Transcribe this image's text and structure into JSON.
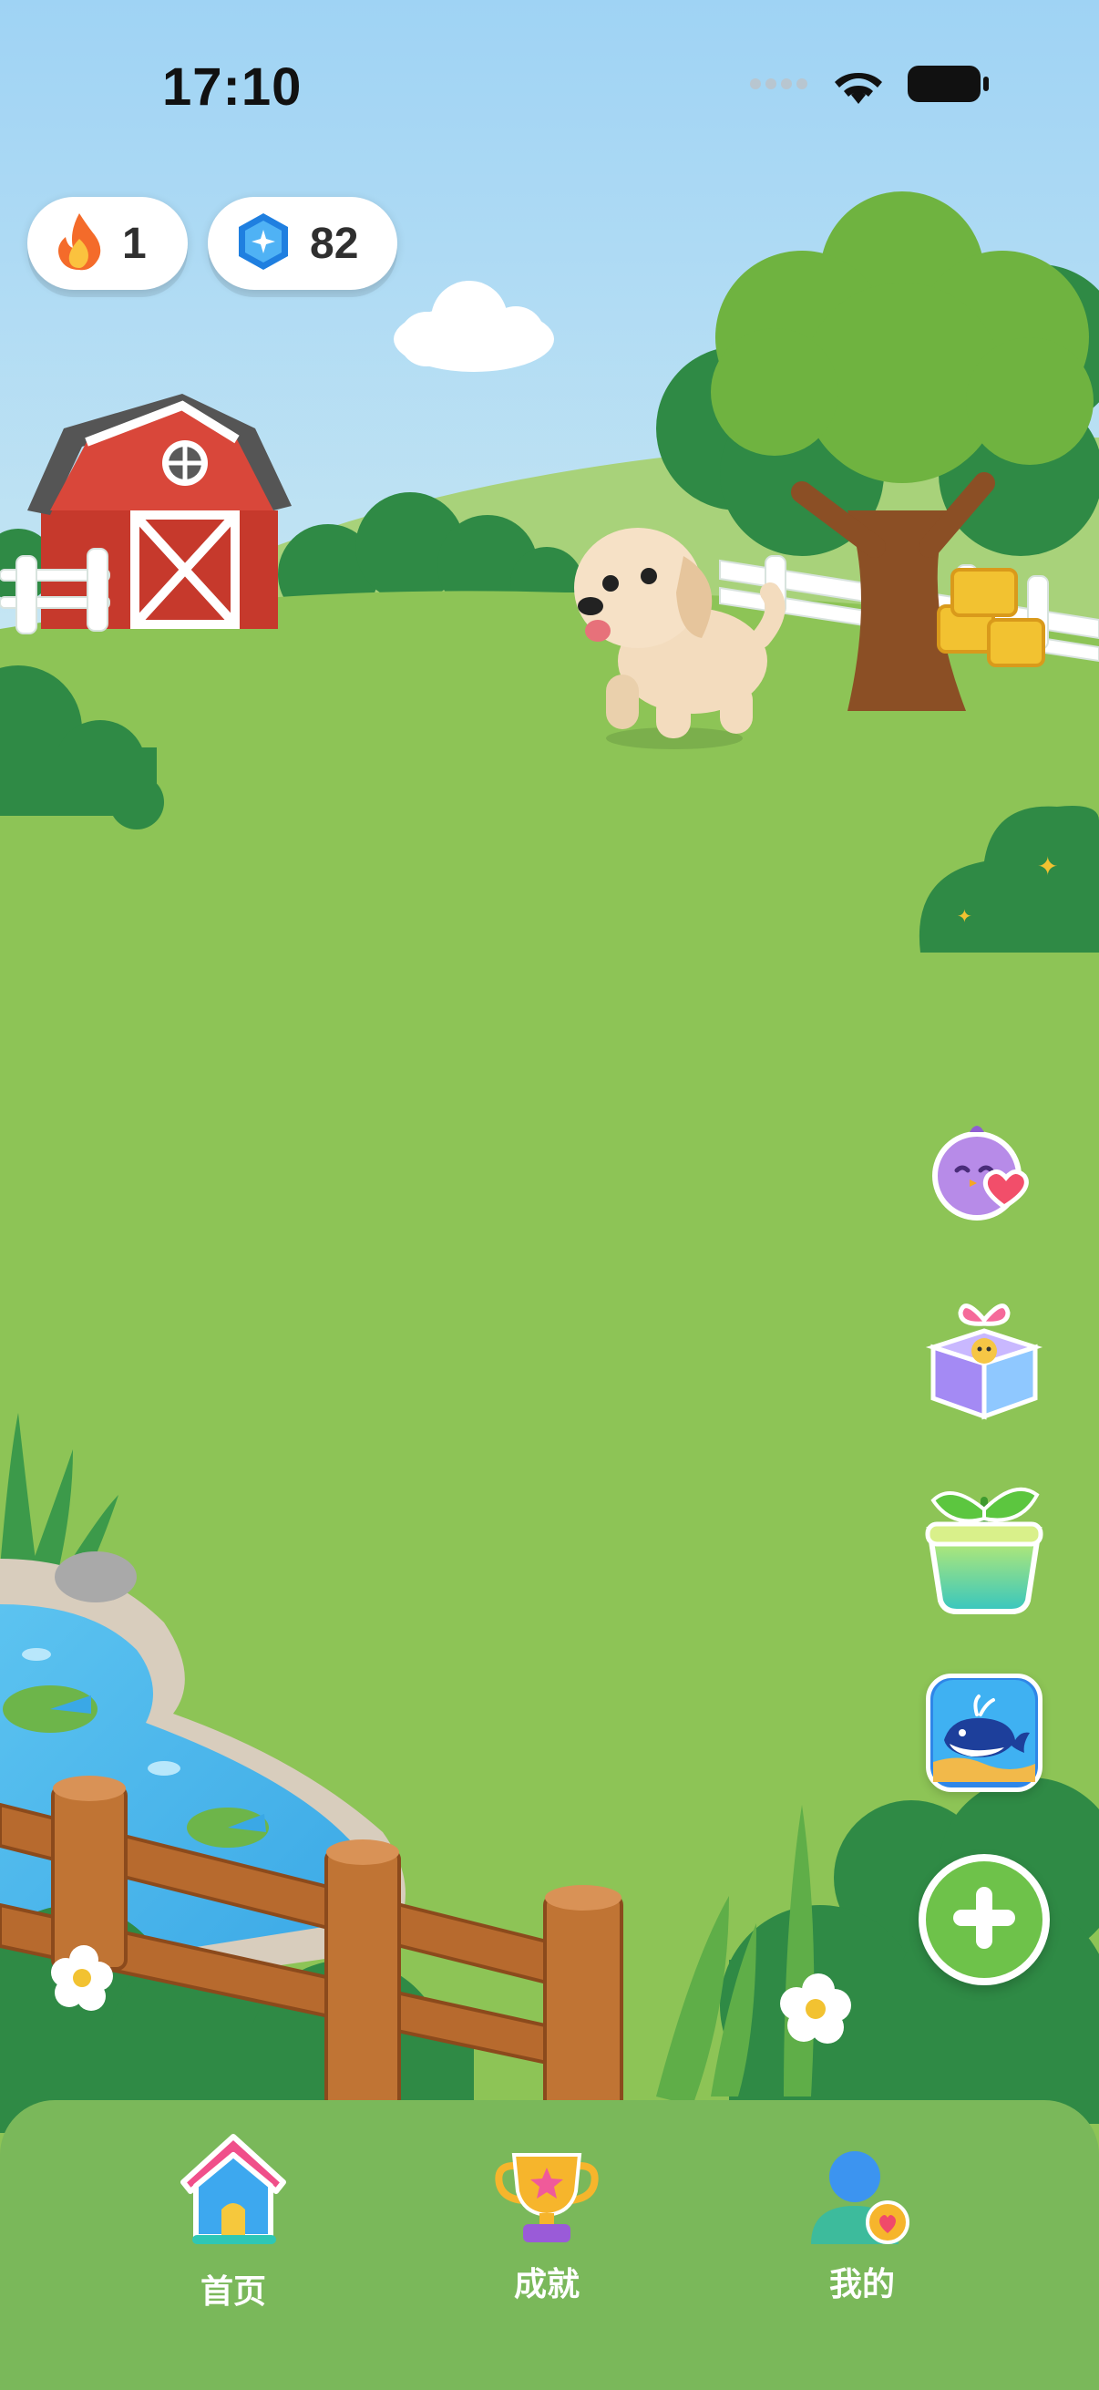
{
  "status_bar": {
    "time": "17:10"
  },
  "counters": {
    "streak": {
      "icon": "flame-icon",
      "value": "1"
    },
    "gems": {
      "icon": "gem-icon",
      "value": "82"
    }
  },
  "side_actions": [
    {
      "icon": "bird-heart-icon"
    },
    {
      "icon": "gift-box-icon"
    },
    {
      "icon": "sprout-pot-icon"
    },
    {
      "icon": "whale-aquarium-icon"
    }
  ],
  "add_button": {
    "icon": "plus-icon"
  },
  "tabs": [
    {
      "label": "首页",
      "icon": "house-icon",
      "active": true
    },
    {
      "label": "成就",
      "icon": "trophy-icon",
      "active": false
    },
    {
      "label": "我的",
      "icon": "profile-icon",
      "active": false
    }
  ],
  "colors": {
    "sky": "#a6d8f5",
    "grass": "#8dc456",
    "tabbar": "#7ab85a",
    "add_button": "#6ec24a"
  }
}
